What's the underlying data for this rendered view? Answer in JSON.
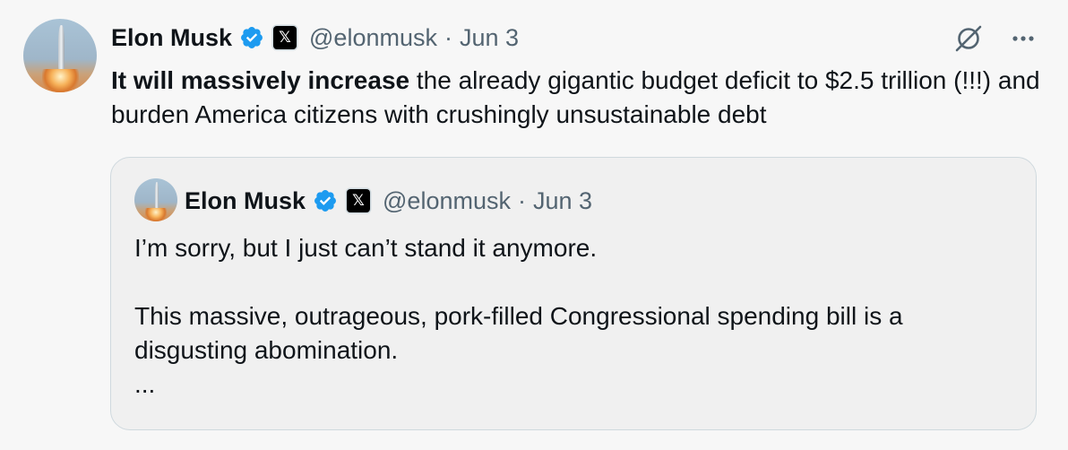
{
  "tweet": {
    "author": {
      "name": "Elon Musk",
      "handle": "@elonmusk",
      "separator": "·",
      "date": "Jun 3",
      "avatar_icon": "rocket-launch-avatar",
      "verified_icon": "verified-badge-icon",
      "affiliate_icon": "x-logo-icon",
      "affiliate_glyph": "𝕏"
    },
    "actions": {
      "grok_icon": "grok-icon",
      "more_icon": "more-options-icon"
    },
    "text": {
      "bold": "It will massively increase",
      "rest": " the already gigantic budget deficit to $2.5 trillion (!!!) and burden America citizens with crushingly unsustainable debt"
    }
  },
  "quoted_tweet": {
    "author": {
      "name": "Elon Musk",
      "handle": "@elonmusk",
      "separator": "·",
      "date": "Jun 3",
      "affiliate_glyph": "𝕏"
    },
    "paragraphs": [
      "I’m sorry, but I just can’t stand it anymore.",
      "This massive, outrageous, pork-filled Congressional spending bill is a disgusting abomination.",
      "..."
    ]
  },
  "colors": {
    "background": "#f7f7f7",
    "text_primary": "#0f1419",
    "text_secondary": "#536471",
    "verified_blue": "#1d9bf0",
    "card_border": "#cfd9de"
  }
}
